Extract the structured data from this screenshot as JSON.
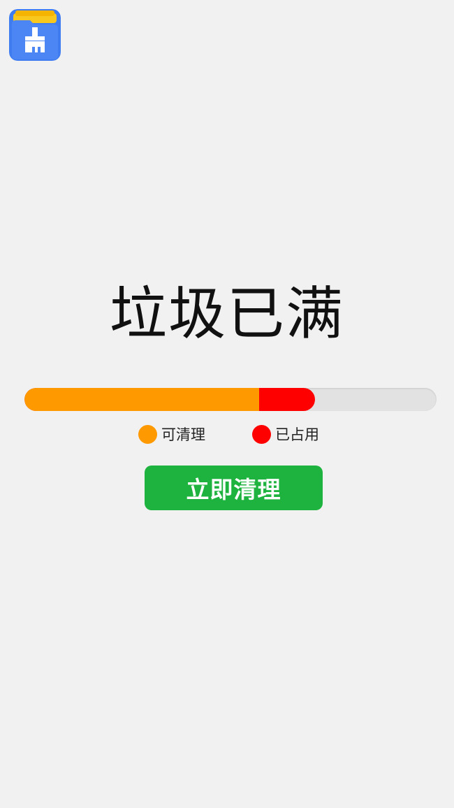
{
  "app": {
    "icon_name": "cleaner-folder-broom-icon"
  },
  "status": {
    "headline": "垃圾已满"
  },
  "storage_bar": {
    "cleanable_fraction": 0.57,
    "occupied_fraction": 0.705
  },
  "legend": {
    "cleanable_label": "可清理",
    "occupied_label": "已占用"
  },
  "action": {
    "clean_now_label": "立即清理"
  },
  "colors": {
    "background": "#f1f1f1",
    "cleanable": "#ff9900",
    "occupied": "#ff0000",
    "track": "#e2e2e2",
    "button": "#1db33e",
    "icon_blue": "#3f7cf0",
    "icon_yellow": "#f8c81e"
  }
}
